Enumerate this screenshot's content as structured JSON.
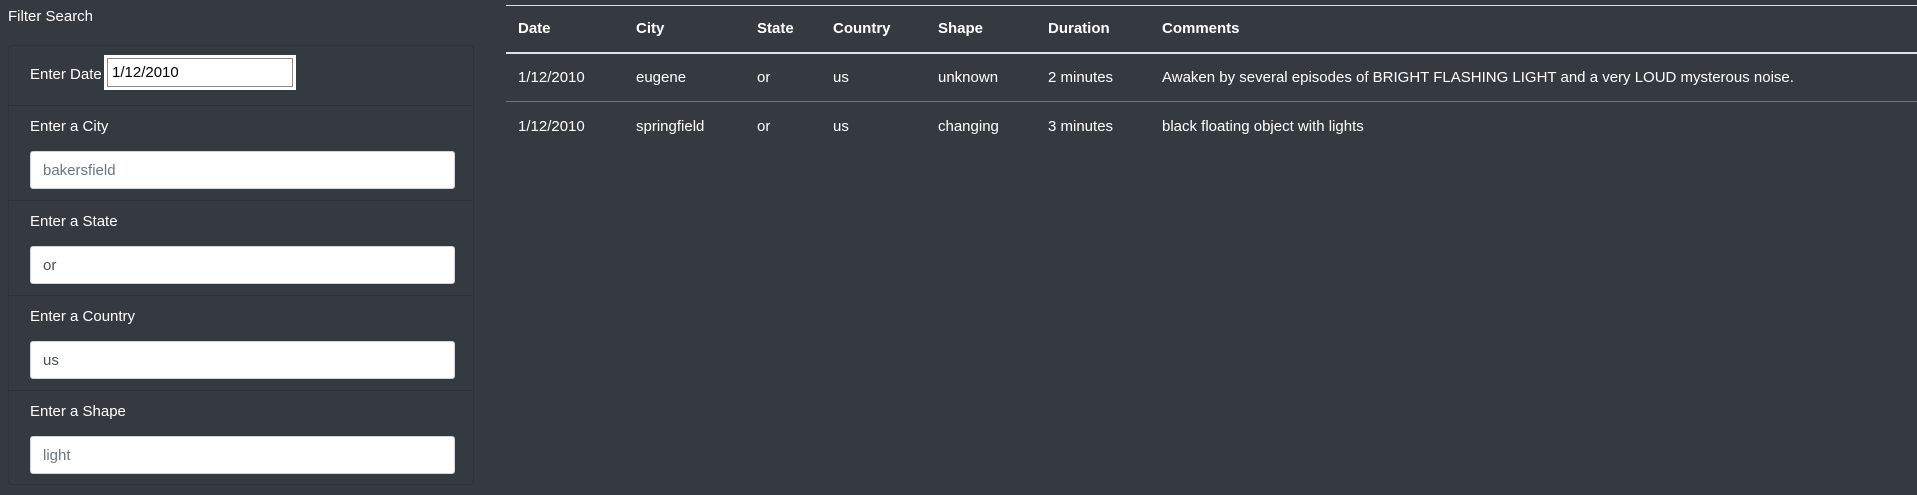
{
  "sidebar": {
    "title": "Filter Search",
    "date": {
      "label": "Enter Date",
      "value": "1/12/2010"
    },
    "city": {
      "label": "Enter a City",
      "placeholder": "bakersfield",
      "value": ""
    },
    "state": {
      "label": "Enter a State",
      "placeholder": "",
      "value": "or"
    },
    "country": {
      "label": "Enter a Country",
      "placeholder": "",
      "value": "us"
    },
    "shape": {
      "label": "Enter a Shape",
      "placeholder": "light",
      "value": ""
    }
  },
  "table": {
    "headers": [
      "Date",
      "City",
      "State",
      "Country",
      "Shape",
      "Duration",
      "Comments"
    ],
    "rows": [
      [
        "1/12/2010",
        "eugene",
        "or",
        "us",
        "unknown",
        "2 minutes",
        "Awaken by several episodes of BRIGHT FLASHING LIGHT and a very LOUD mysterous noise."
      ],
      [
        "1/12/2010",
        "springfield",
        "or",
        "us",
        "changing",
        "3 minutes",
        "black floating object with lights"
      ]
    ]
  },
  "colors": {
    "background": "#343a40",
    "text": "#ffffff",
    "input_bg": "#ffffff"
  }
}
